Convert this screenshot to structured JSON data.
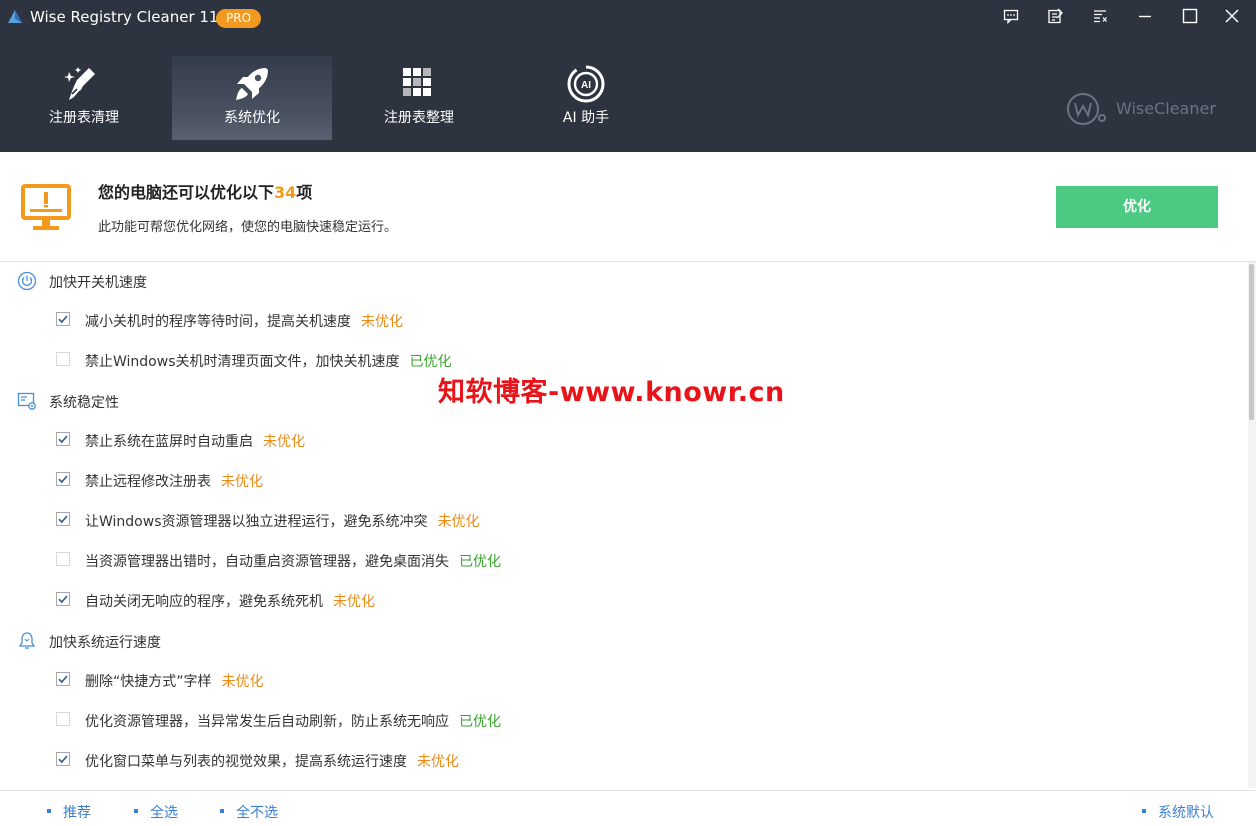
{
  "titlebar": {
    "app_title": "Wise Registry Cleaner 11",
    "badge": "PRO",
    "buttons": [
      "feedback-icon",
      "edit-icon",
      "menu-icon",
      "minimize-icon",
      "maximize-icon",
      "close-icon"
    ]
  },
  "tabs": [
    {
      "label": "注册表清理",
      "icon": "broom-icon",
      "active": false
    },
    {
      "label": "系统优化",
      "icon": "rocket-icon",
      "active": true
    },
    {
      "label": "注册表整理",
      "icon": "blocks-icon",
      "active": false
    },
    {
      "label": "AI 助手",
      "icon": "ai-icon",
      "active": false
    }
  ],
  "brand": {
    "text": "WiseCleaner"
  },
  "summary": {
    "title_prefix": "您的电脑还可以优化以下",
    "count": "34",
    "title_suffix": "项",
    "subtitle": "此功能可帮您优化网络，使您的电脑快速稳定运行。",
    "button": "优化"
  },
  "groups": [
    {
      "label": "加快开关机速度",
      "icon": "power-icon",
      "items": [
        {
          "label": "减小关机时的程序等待时间，提高关机速度",
          "status": "未优化",
          "checked": true
        },
        {
          "label": "禁止Windows关机时清理页面文件，加快关机速度",
          "status": "已优化",
          "checked": false
        }
      ]
    },
    {
      "label": "系统稳定性",
      "icon": "system-settings-icon",
      "items": [
        {
          "label": "禁止系统在蓝屏时自动重启",
          "status": "未优化",
          "checked": true
        },
        {
          "label": "禁止远程修改注册表",
          "status": "未优化",
          "checked": true
        },
        {
          "label": "让Windows资源管理器以独立进程运行，避免系统冲突",
          "status": "未优化",
          "checked": true
        },
        {
          "label": "当资源管理器出错时，自动重启资源管理器，避免桌面消失",
          "status": "已优化",
          "checked": false
        },
        {
          "label": "自动关闭无响应的程序，避免系统死机",
          "status": "未优化",
          "checked": true
        }
      ]
    },
    {
      "label": "加快系统运行速度",
      "icon": "bell-icon",
      "items": [
        {
          "label": "删除“快捷方式”字样",
          "status": "未优化",
          "checked": true
        },
        {
          "label": "优化资源管理器，当异常发生后自动刷新，防止系统无响应",
          "status": "已优化",
          "checked": false
        },
        {
          "label": "优化窗口菜单与列表的视觉效果，提高系统运行速度",
          "status": "未优化",
          "checked": true
        }
      ]
    }
  ],
  "watermark": "知软博客-www.knowr.cn",
  "footer": {
    "recommend": "推荐",
    "select_all": "全选",
    "select_none": "全不选",
    "system_default": "系统默认"
  },
  "colors": {
    "header_bg": "#2e3340",
    "accent_green": "#4cca84",
    "accent_orange": "#f39a1c",
    "status_warn": "#e98a16",
    "status_ok": "#36a72a",
    "link_blue": "#3a7fd0"
  }
}
